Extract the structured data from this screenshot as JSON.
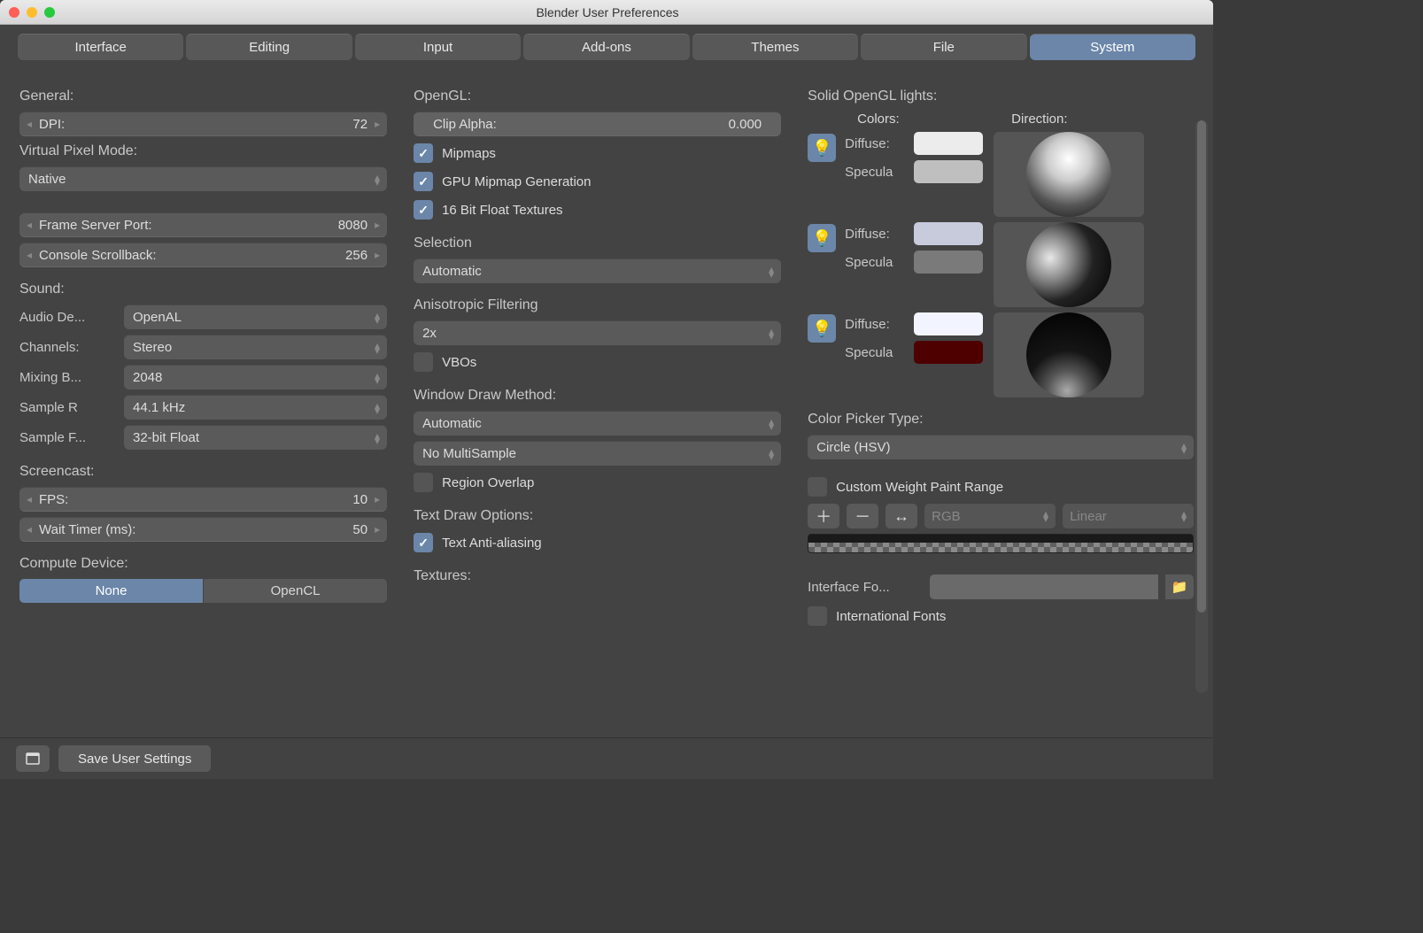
{
  "window": {
    "title": "Blender User Preferences"
  },
  "tabs": [
    "Interface",
    "Editing",
    "Input",
    "Add-ons",
    "Themes",
    "File",
    "System"
  ],
  "active_tab": "System",
  "general": {
    "label": "General:",
    "dpi_label": "DPI:",
    "dpi_value": "72",
    "vpm_label": "Virtual Pixel Mode:",
    "vpm_value": "Native",
    "frame_port_label": "Frame Server Port:",
    "frame_port_value": "8080",
    "console_label": "Console Scrollback:",
    "console_value": "256"
  },
  "sound": {
    "label": "Sound:",
    "device_label": "Audio De...",
    "device_value": "OpenAL",
    "channels_label": "Channels:",
    "channels_value": "Stereo",
    "mixing_label": "Mixing B...",
    "mixing_value": "2048",
    "sample_rate_label": "Sample R",
    "sample_rate_value": "44.1 kHz",
    "sample_fmt_label": "Sample F...",
    "sample_fmt_value": "32-bit Float"
  },
  "screencast": {
    "label": "Screencast:",
    "fps_label": "FPS:",
    "fps_value": "10",
    "wait_label": "Wait Timer (ms):",
    "wait_value": "50"
  },
  "compute": {
    "label": "Compute Device:",
    "none": "None",
    "opencl": "OpenCL"
  },
  "opengl": {
    "label": "OpenGL:",
    "clip_label": "Clip Alpha:",
    "clip_value": "0.000",
    "mipmaps": "Mipmaps",
    "gpu_mip": "GPU Mipmap Generation",
    "float16": "16 Bit Float Textures",
    "selection_label": "Selection",
    "selection_value": "Automatic",
    "aniso_label": "Anisotropic Filtering",
    "aniso_value": "2x",
    "vbos": "VBOs",
    "wdm_label": "Window Draw Method:",
    "wdm_value": "Automatic",
    "multisample": "No MultiSample",
    "region_overlap": "Region Overlap",
    "text_draw_label": "Text Draw Options:",
    "text_aa": "Text Anti-aliasing",
    "textures_label": "Textures:"
  },
  "lights": {
    "label": "Solid OpenGL lights:",
    "colors_label": "Colors:",
    "direction_label": "Direction:",
    "diffuse_label": "Diffuse:",
    "specular_label": "Specula",
    "l1": {
      "diffuse": "#ececec",
      "specular": "#bfbfbf"
    },
    "l2": {
      "diffuse": "#c7cbdc",
      "specular": "#7a7a7a"
    },
    "l3": {
      "diffuse": "#f2f4ff",
      "specular": "#4e0000"
    }
  },
  "color_picker": {
    "label": "Color Picker Type:",
    "value": "Circle (HSV)"
  },
  "weight": {
    "label": "Custom Weight Paint Range",
    "rgb": "RGB",
    "interp": "Linear"
  },
  "font": {
    "label": "Interface Fo...",
    "intl": "International Fonts"
  },
  "footer": {
    "save": "Save User Settings"
  }
}
